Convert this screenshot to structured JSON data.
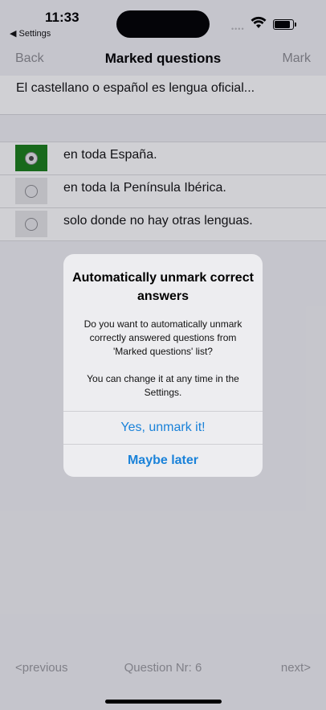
{
  "status_bar": {
    "time": "11:33",
    "back_app": "◀ Settings",
    "signal": "••••"
  },
  "nav": {
    "back": "Back",
    "title": "Marked questions",
    "mark": "Mark"
  },
  "question": {
    "text": "El castellano o español es lengua oficial..."
  },
  "answers": [
    {
      "label": "en toda España.",
      "selected": true
    },
    {
      "label": "en toda la Península Ibérica.",
      "selected": false
    },
    {
      "label": "solo donde no hay otras lenguas.",
      "selected": false
    }
  ],
  "footer": {
    "previous": "<previous",
    "question_nr": "Question Nr: 6",
    "next": "next>"
  },
  "alert": {
    "title": "Automatically unmark correct answers",
    "message": "Do you want to automatically unmark correctly answered questions from 'Marked questions' list?\n\nYou can change it at any time in the Settings.",
    "primary_button": "Yes, unmark it!",
    "secondary_button": "Maybe later"
  },
  "colors": {
    "selected_answer": "#1a7f1a",
    "alert_button": "#1a82d9"
  }
}
